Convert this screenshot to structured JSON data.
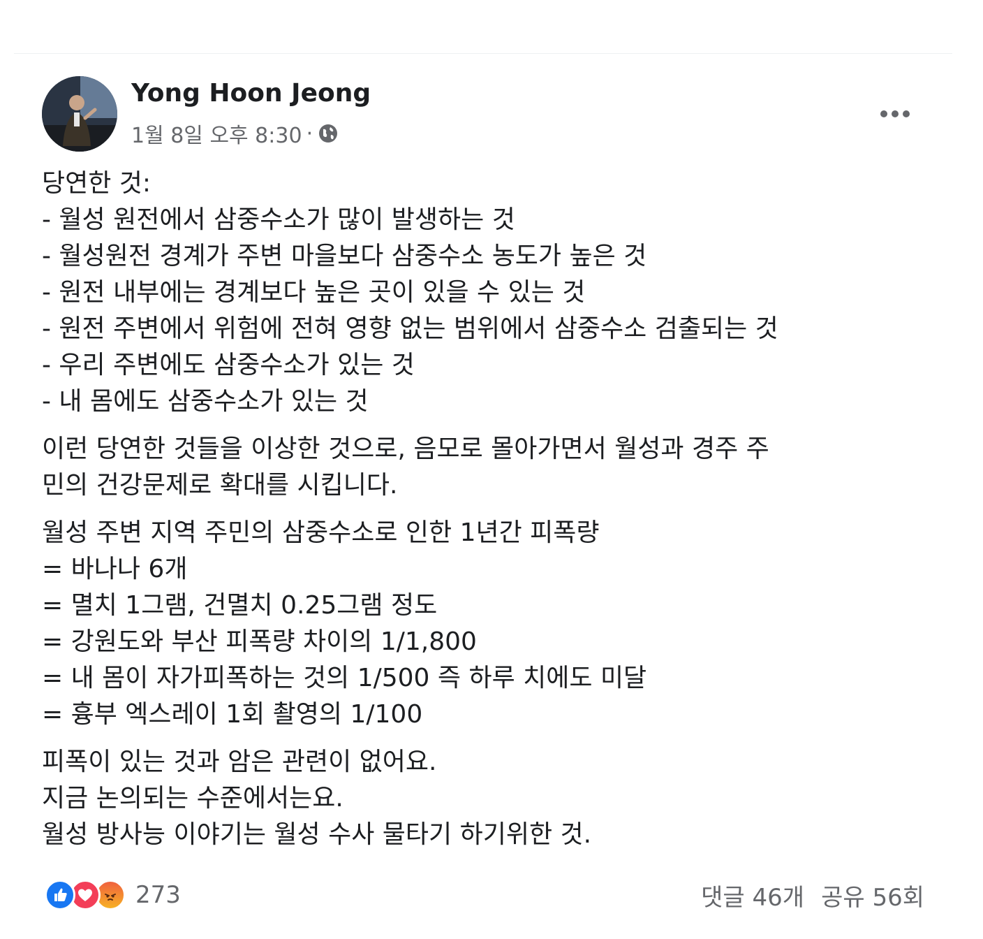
{
  "post": {
    "author": "Yong Hoon Jeong",
    "timestamp": "1월 8일 오후 8:30",
    "separator": "·",
    "privacy_icon": "globe-icon",
    "more_icon": "more-options-icon"
  },
  "content": {
    "paragraphs": [
      {
        "lines": [
          "당연한 것:",
          "- 월성 원전에서 삼중수소가 많이 발생하는 것",
          "- 월성원전 경계가 주변 마을보다 삼중수소 농도가 높은 것",
          "- 원전 내부에는 경계보다 높은 곳이 있을 수 있는 것",
          "- 원전 주변에서 위험에 전혀 영향 없는 범위에서 삼중수소 검출되는 것",
          "- 우리 주변에도 삼중수소가 있는 것",
          "- 내 몸에도 삼중수소가 있는 것"
        ]
      },
      {
        "lines": [
          "이런 당연한 것들을 이상한 것으로, 음모로 몰아가면서 월성과 경주 주",
          "민의 건강문제로 확대를 시킵니다."
        ]
      },
      {
        "lines": [
          "월성 주변 지역 주민의 삼중수소로 인한 1년간 피폭량",
          "= 바나나 6개",
          "= 멸치 1그램, 건멸치 0.25그램 정도",
          "= 강원도와 부산 피폭량 차이의 1/1,800",
          "= 내 몸이 자가피폭하는 것의 1/500  즉 하루 치에도 미달",
          "= 흉부 엑스레이 1회 촬영의 1/100"
        ]
      },
      {
        "lines": [
          "피폭이 있는 것과 암은 관련이 없어요.",
          "지금 논의되는 수준에서는요.",
          "월성 방사능 이야기는 월성 수사 물타기 하기위한 것."
        ]
      }
    ]
  },
  "footer": {
    "reactions": [
      "like-icon",
      "love-icon",
      "angry-icon"
    ],
    "reaction_count": "273",
    "comments": "댓글 46개",
    "shares": "공유 56회"
  },
  "colors": {
    "like": "#1877f2",
    "love": "#f33e58",
    "angry": "#f0613e",
    "secondary_text": "#65676b"
  }
}
